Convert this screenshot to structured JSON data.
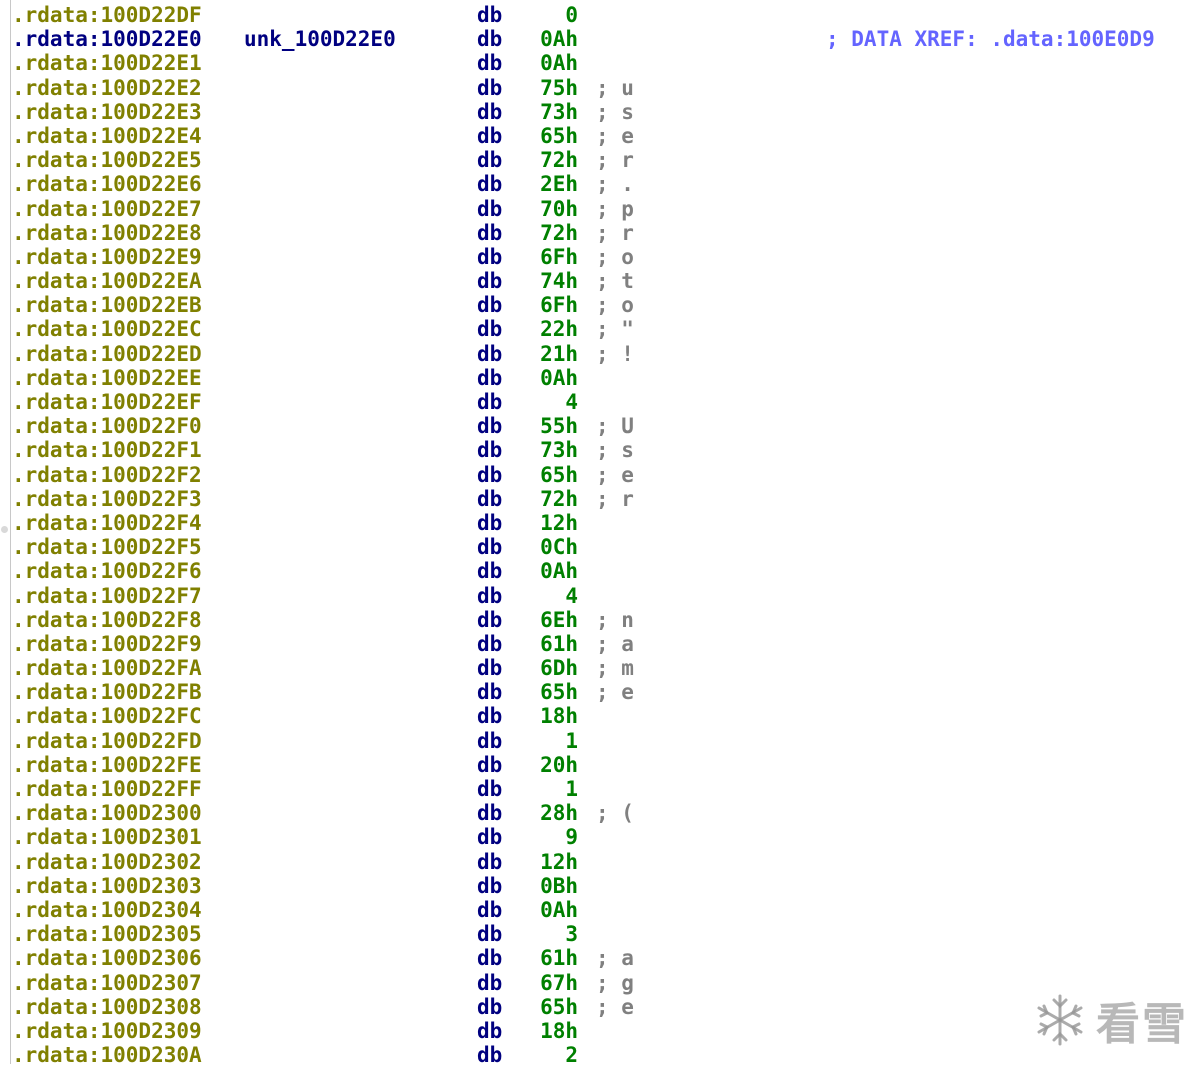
{
  "listing": {
    "operator": "db",
    "rows": [
      {
        "address": ".rdata:100D22DF",
        "label": "",
        "value": "0",
        "char": "",
        "comment": ""
      },
      {
        "address": ".rdata:100D22E0",
        "label": "unk_100D22E0",
        "value": "0Ah",
        "char": "",
        "comment": "; DATA XREF: .data:100E0D9"
      },
      {
        "address": ".rdata:100D22E1",
        "label": "",
        "value": "0Ah",
        "char": "",
        "comment": ""
      },
      {
        "address": ".rdata:100D22E2",
        "label": "",
        "value": "75h",
        "char": "; u",
        "comment": ""
      },
      {
        "address": ".rdata:100D22E3",
        "label": "",
        "value": "73h",
        "char": "; s",
        "comment": ""
      },
      {
        "address": ".rdata:100D22E4",
        "label": "",
        "value": "65h",
        "char": "; e",
        "comment": ""
      },
      {
        "address": ".rdata:100D22E5",
        "label": "",
        "value": "72h",
        "char": "; r",
        "comment": ""
      },
      {
        "address": ".rdata:100D22E6",
        "label": "",
        "value": "2Eh",
        "char": "; .",
        "comment": ""
      },
      {
        "address": ".rdata:100D22E7",
        "label": "",
        "value": "70h",
        "char": "; p",
        "comment": ""
      },
      {
        "address": ".rdata:100D22E8",
        "label": "",
        "value": "72h",
        "char": "; r",
        "comment": ""
      },
      {
        "address": ".rdata:100D22E9",
        "label": "",
        "value": "6Fh",
        "char": "; o",
        "comment": ""
      },
      {
        "address": ".rdata:100D22EA",
        "label": "",
        "value": "74h",
        "char": "; t",
        "comment": ""
      },
      {
        "address": ".rdata:100D22EB",
        "label": "",
        "value": "6Fh",
        "char": "; o",
        "comment": ""
      },
      {
        "address": ".rdata:100D22EC",
        "label": "",
        "value": "22h",
        "char": "; \"",
        "comment": ""
      },
      {
        "address": ".rdata:100D22ED",
        "label": "",
        "value": "21h",
        "char": "; !",
        "comment": ""
      },
      {
        "address": ".rdata:100D22EE",
        "label": "",
        "value": "0Ah",
        "char": "",
        "comment": ""
      },
      {
        "address": ".rdata:100D22EF",
        "label": "",
        "value": "4",
        "char": "",
        "comment": ""
      },
      {
        "address": ".rdata:100D22F0",
        "label": "",
        "value": "55h",
        "char": "; U",
        "comment": ""
      },
      {
        "address": ".rdata:100D22F1",
        "label": "",
        "value": "73h",
        "char": "; s",
        "comment": ""
      },
      {
        "address": ".rdata:100D22F2",
        "label": "",
        "value": "65h",
        "char": "; e",
        "comment": ""
      },
      {
        "address": ".rdata:100D22F3",
        "label": "",
        "value": "72h",
        "char": "; r",
        "comment": ""
      },
      {
        "address": ".rdata:100D22F4",
        "label": "",
        "value": "12h",
        "char": "",
        "comment": ""
      },
      {
        "address": ".rdata:100D22F5",
        "label": "",
        "value": "0Ch",
        "char": "",
        "comment": ""
      },
      {
        "address": ".rdata:100D22F6",
        "label": "",
        "value": "0Ah",
        "char": "",
        "comment": ""
      },
      {
        "address": ".rdata:100D22F7",
        "label": "",
        "value": "4",
        "char": "",
        "comment": ""
      },
      {
        "address": ".rdata:100D22F8",
        "label": "",
        "value": "6Eh",
        "char": "; n",
        "comment": ""
      },
      {
        "address": ".rdata:100D22F9",
        "label": "",
        "value": "61h",
        "char": "; a",
        "comment": ""
      },
      {
        "address": ".rdata:100D22FA",
        "label": "",
        "value": "6Dh",
        "char": "; m",
        "comment": ""
      },
      {
        "address": ".rdata:100D22FB",
        "label": "",
        "value": "65h",
        "char": "; e",
        "comment": ""
      },
      {
        "address": ".rdata:100D22FC",
        "label": "",
        "value": "18h",
        "char": "",
        "comment": ""
      },
      {
        "address": ".rdata:100D22FD",
        "label": "",
        "value": "1",
        "char": "",
        "comment": ""
      },
      {
        "address": ".rdata:100D22FE",
        "label": "",
        "value": "20h",
        "char": "",
        "comment": ""
      },
      {
        "address": ".rdata:100D22FF",
        "label": "",
        "value": "1",
        "char": "",
        "comment": ""
      },
      {
        "address": ".rdata:100D2300",
        "label": "",
        "value": "28h",
        "char": "; (",
        "comment": ""
      },
      {
        "address": ".rdata:100D2301",
        "label": "",
        "value": "9",
        "char": "",
        "comment": ""
      },
      {
        "address": ".rdata:100D2302",
        "label": "",
        "value": "12h",
        "char": "",
        "comment": ""
      },
      {
        "address": ".rdata:100D2303",
        "label": "",
        "value": "0Bh",
        "char": "",
        "comment": ""
      },
      {
        "address": ".rdata:100D2304",
        "label": "",
        "value": "0Ah",
        "char": "",
        "comment": ""
      },
      {
        "address": ".rdata:100D2305",
        "label": "",
        "value": "3",
        "char": "",
        "comment": ""
      },
      {
        "address": ".rdata:100D2306",
        "label": "",
        "value": "61h",
        "char": "; a",
        "comment": ""
      },
      {
        "address": ".rdata:100D2307",
        "label": "",
        "value": "67h",
        "char": "; g",
        "comment": ""
      },
      {
        "address": ".rdata:100D2308",
        "label": "",
        "value": "65h",
        "char": "; e",
        "comment": ""
      },
      {
        "address": ".rdata:100D2309",
        "label": "",
        "value": "18h",
        "char": "",
        "comment": ""
      },
      {
        "address": ".rdata:100D230A",
        "label": "",
        "value": "2",
        "char": "",
        "comment": ""
      }
    ]
  },
  "watermark": {
    "text": "看雪",
    "icon": "snowflake-icon"
  },
  "colors": {
    "address": "#808000",
    "current_address": "#000080",
    "operator": "#000080",
    "value": "#008000",
    "char_comment": "#808080",
    "xref": "#6464ff"
  }
}
